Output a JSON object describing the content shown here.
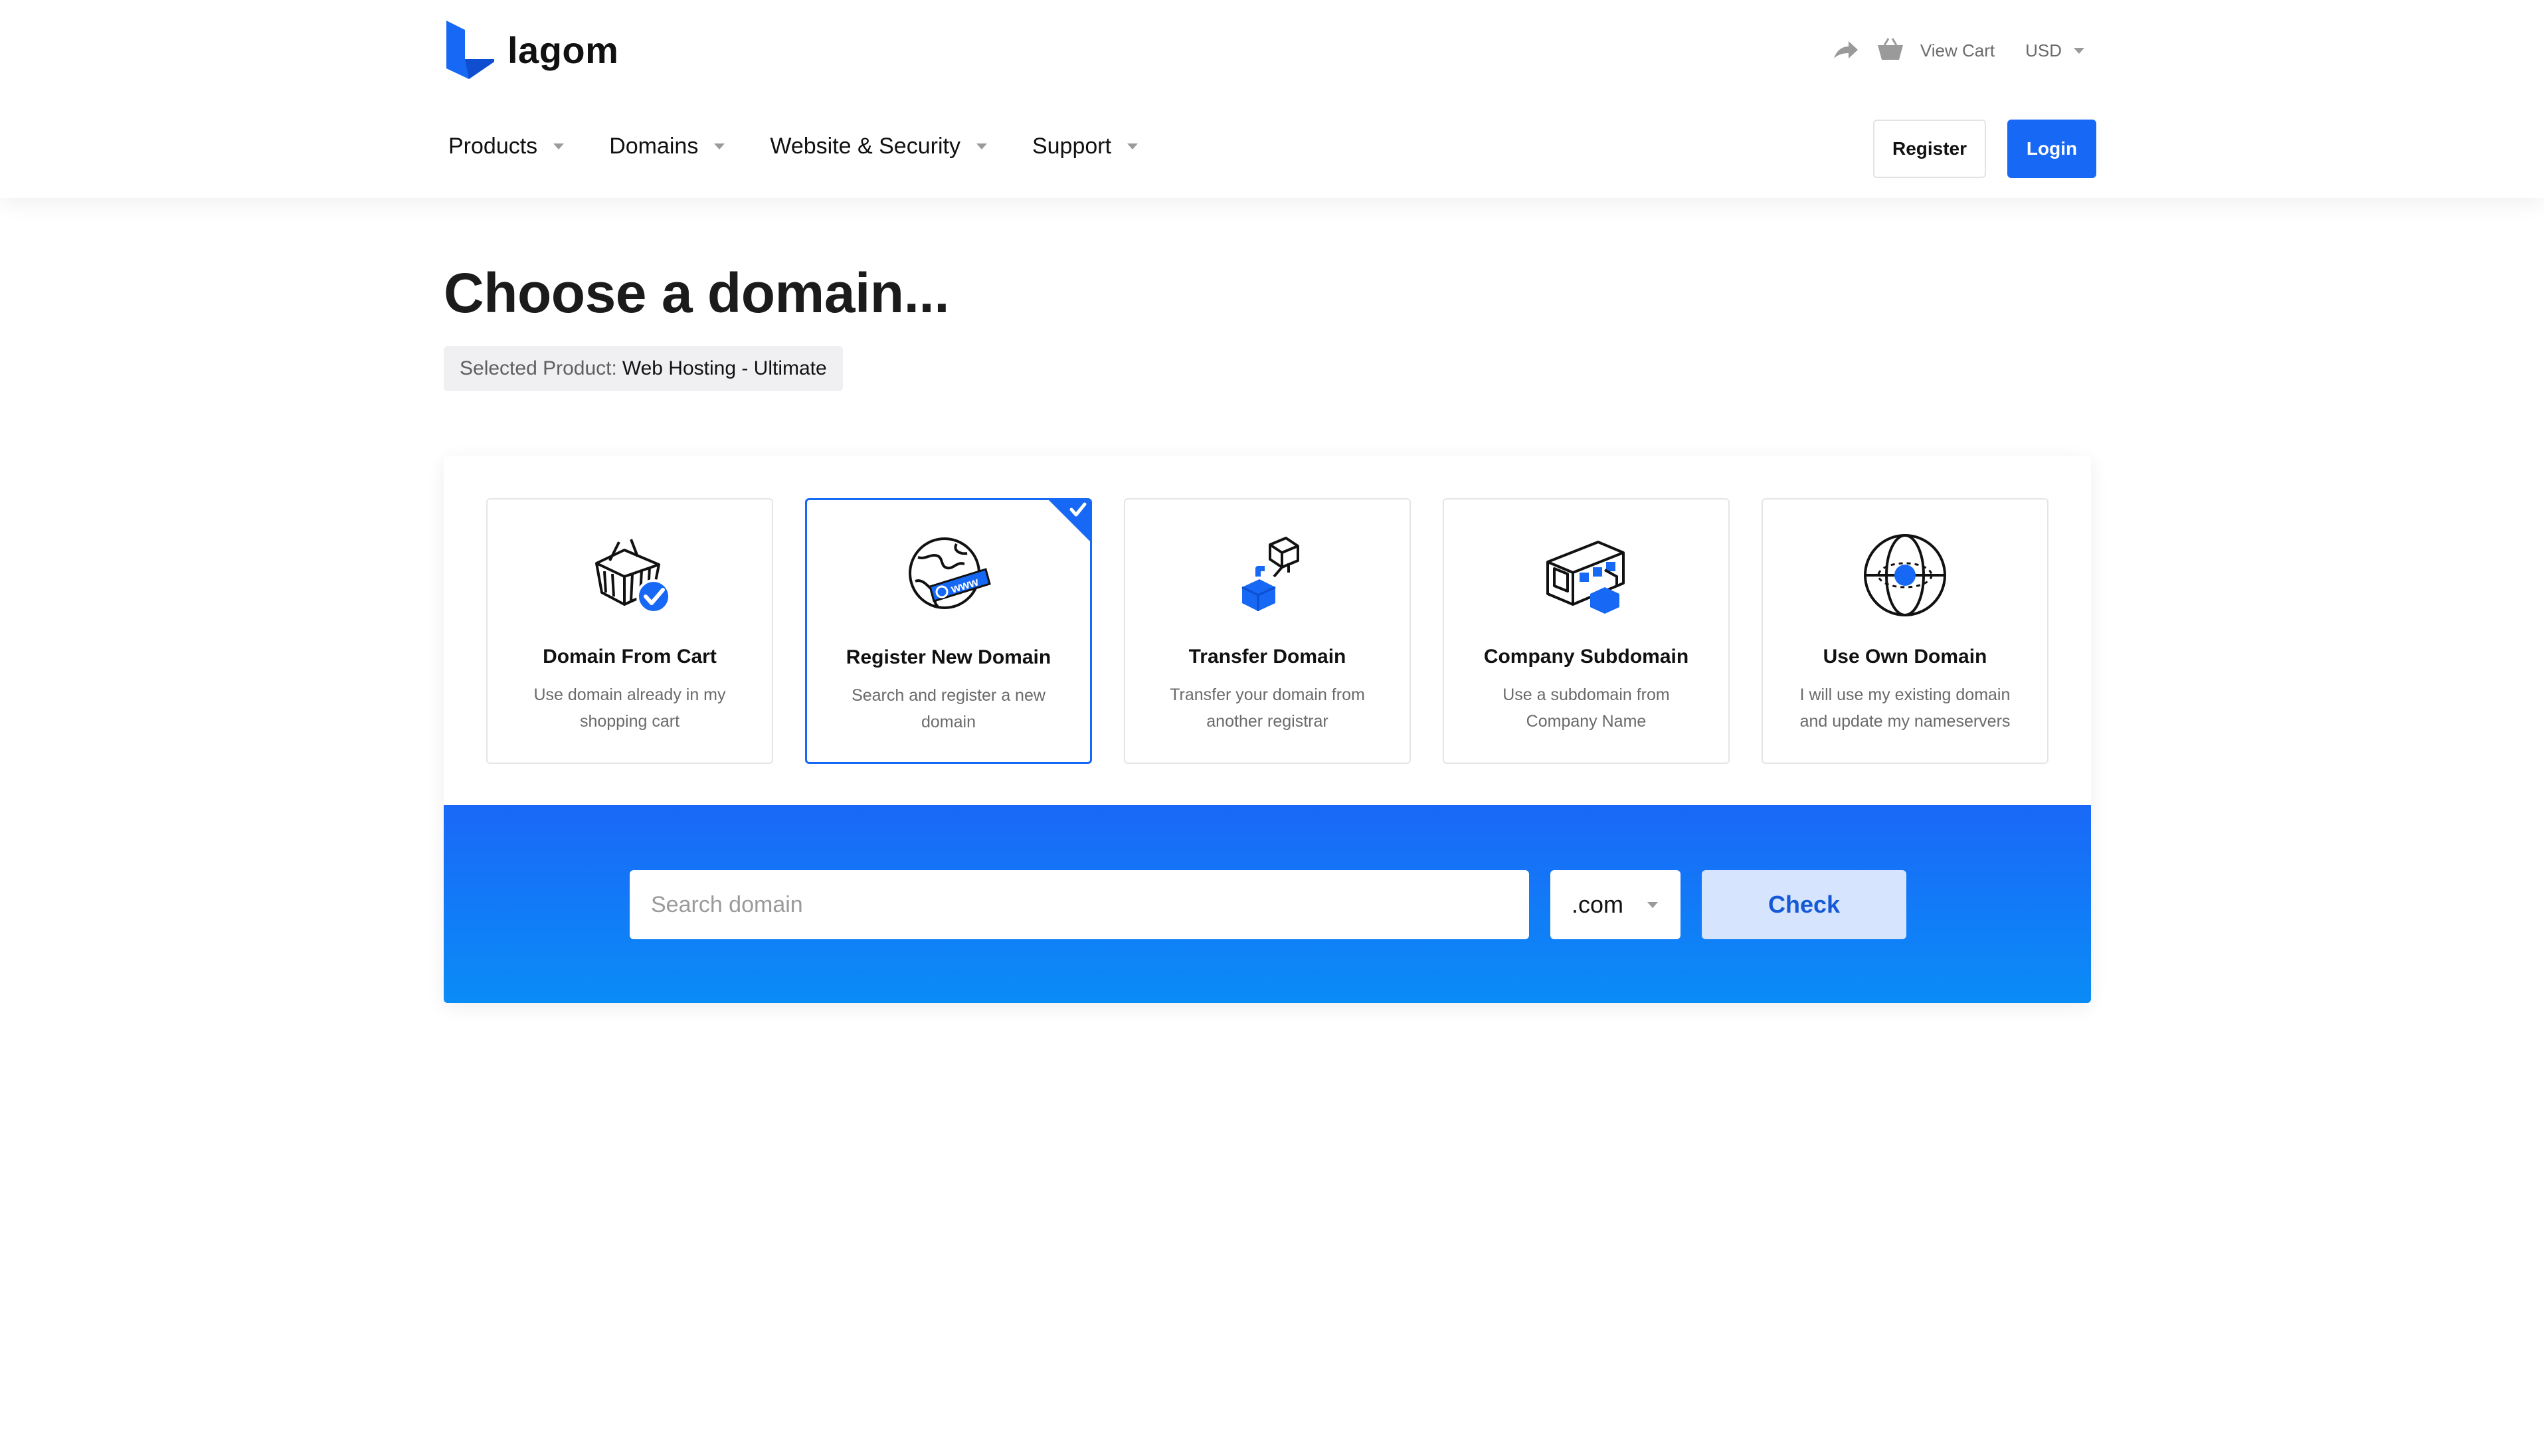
{
  "brand": {
    "name": "lagom",
    "accent": "#1668f5"
  },
  "topbar": {
    "view_cart": "View Cart",
    "currency": "USD"
  },
  "nav": {
    "items": [
      {
        "label": "Products"
      },
      {
        "label": "Domains"
      },
      {
        "label": "Website & Security"
      },
      {
        "label": "Support"
      }
    ],
    "register": "Register",
    "login": "Login"
  },
  "page": {
    "title": "Choose a domain...",
    "selected_label": "Selected Product:",
    "selected_value": "Web Hosting - Ultimate"
  },
  "options": [
    {
      "title": "Domain From Cart",
      "desc": "Use domain already in my shopping cart",
      "icon": "basket-check-icon",
      "selected": false
    },
    {
      "title": "Register New Domain",
      "desc": "Search and register a new domain",
      "icon": "globe-www-icon",
      "selected": true
    },
    {
      "title": "Transfer Domain",
      "desc": "Transfer your domain from another registrar",
      "icon": "transfer-boxes-icon",
      "selected": false
    },
    {
      "title": "Company Subdomain",
      "desc": "Use a subdomain from Company Name",
      "icon": "browser-subdomain-icon",
      "selected": false
    },
    {
      "title": "Use Own Domain",
      "desc": "I will use my existing domain and update my nameservers",
      "icon": "globe-dot-icon",
      "selected": false
    }
  ],
  "search": {
    "placeholder": "Search domain",
    "value": "",
    "tld": ".com",
    "check": "Check"
  }
}
